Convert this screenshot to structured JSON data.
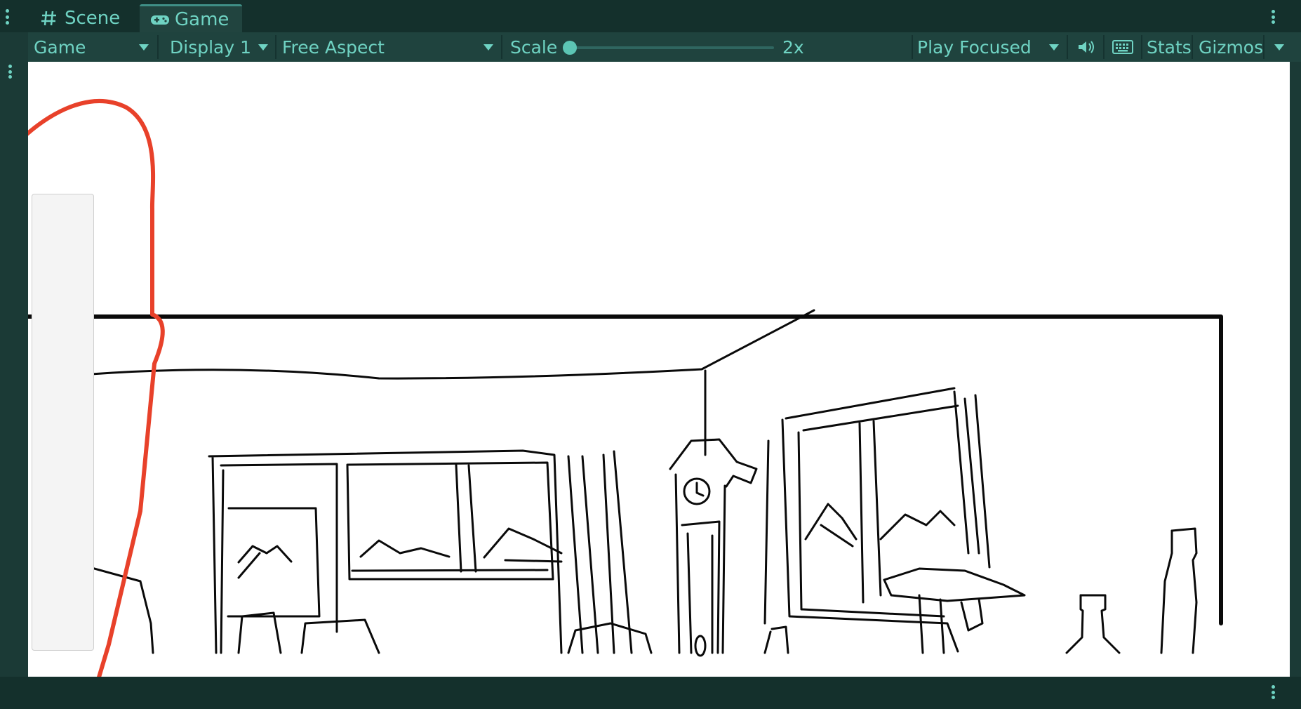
{
  "tabs": [
    {
      "label": "Scene",
      "icon": "grid-hash-icon",
      "active": false
    },
    {
      "label": "Game",
      "icon": "gamepad-icon",
      "active": true
    }
  ],
  "toolbar": {
    "view_type": "Game",
    "display": "Display 1",
    "aspect": "Free Aspect",
    "scale_label": "Scale",
    "scale_value": "2x",
    "scale_fraction": 0.0,
    "play_mode": "Play Focused",
    "audio_icon": "speaker-mute-icon",
    "keyboard_icon": "keyboard-icon",
    "stats_label": "Stats",
    "gizmos_label": "Gizmos"
  },
  "colors": {
    "accent": "#6fd3c3",
    "chrome_dark": "#14302c",
    "chrome": "#1f433e",
    "viewport_bg": "#ffffff",
    "annotation": "#e8412a"
  },
  "viewport": {
    "content": "sketch-room-scene",
    "icons": [
      "window-icon",
      "grandfather-clock-icon",
      "bottle-icon",
      "table-icon",
      "picture-frame-icon"
    ]
  }
}
